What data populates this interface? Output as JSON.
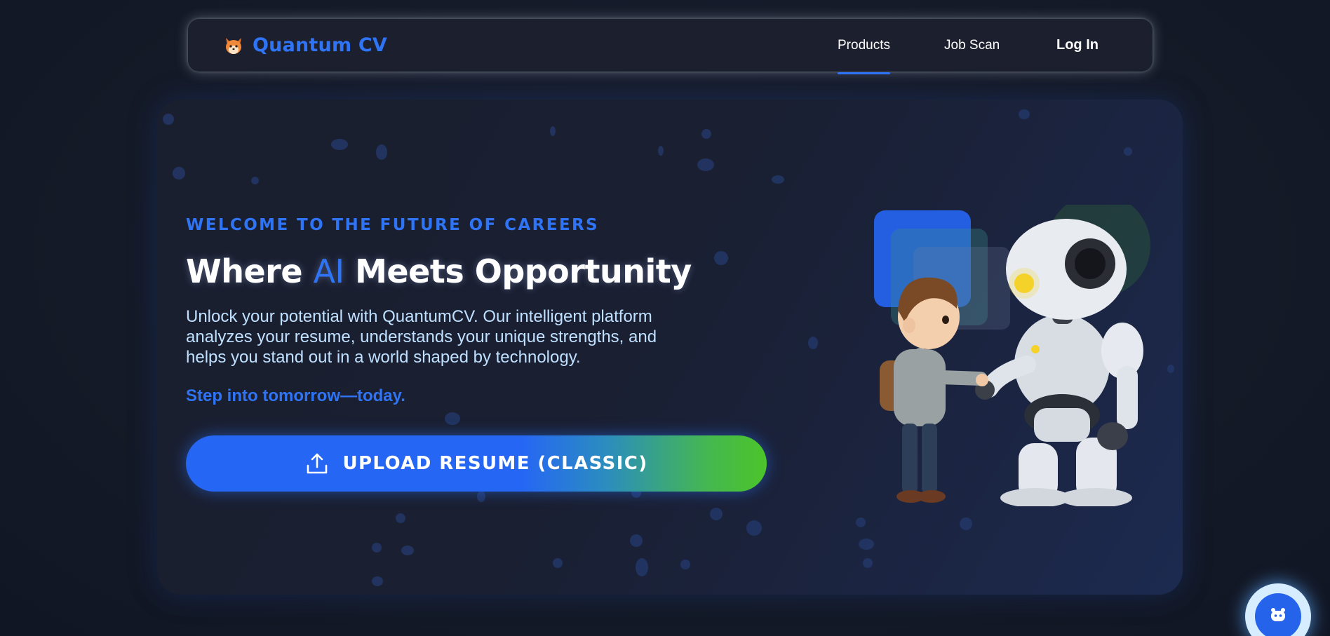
{
  "nav": {
    "brand_name": "Quantum CV",
    "brand_icon": "fox-logo-icon",
    "links": [
      "Products",
      "Job Scan"
    ],
    "login_label": "Log In",
    "active": "Products"
  },
  "hero": {
    "eyebrow": "WELCOME TO THE FUTURE OF CAREERS",
    "headline_pre": "Where ",
    "headline_accent": "AI",
    "headline_post": " Meets Opportunity",
    "description": "Unlock your potential with QuantumCV. Our intelligent platform analyzes your resume, understands your unique strengths, and helps you stand out in a world shaped by technology.",
    "tagline": "Step into tomorrow—today.",
    "upload_button_label": "UPLOAD RESUME (CLASSIC)",
    "upload_icon": "upload-icon",
    "illustration": "boy-and-robot-handshake-illustration"
  },
  "chat": {
    "icon": "chatbot-icon"
  },
  "colors": {
    "accent": "#2f74f5",
    "background": "#151a28",
    "text": "#ffffff",
    "description_text": "#bfe0ff",
    "button_gradient_end": "#4cc42a"
  }
}
